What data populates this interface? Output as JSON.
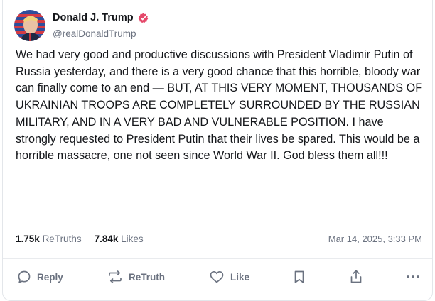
{
  "post": {
    "author_name": "Donald J. Trump",
    "handle": "@realDonaldTrump",
    "text": "We had very good and productive discussions with President Vladimir Putin of Russia yesterday, and there is a very good chance that this horrible, bloody war can finally come to an end — BUT, AT THIS VERY MOMENT, THOUSANDS OF UKRAINIAN TROOPS ARE COMPLETELY SURROUNDED BY THE RUSSIAN MILITARY, AND IN A VERY BAD AND VULNERABLE POSITION. I have strongly requested to President Putin that their lives be spared. This would be a horrible massacre, one not seen since World War II. God bless them all!!!",
    "retruths_count": "1.75k",
    "retruths_label": "ReTruths",
    "likes_count": "7.84k",
    "likes_label": "Likes",
    "timestamp": "Mar 14, 2025, 3:33 PM"
  },
  "actions": {
    "reply_label": "Reply",
    "retruth_label": "ReTruth",
    "like_label": "Like"
  },
  "colors": {
    "verified_badge": "#e5486a",
    "text_primary": "#14161a",
    "text_secondary": "#6b7280"
  },
  "icons": {
    "verified": "verified-badge-icon",
    "reply": "speech-bubble-icon",
    "retruth": "retruth-arrows-icon",
    "like": "heart-icon",
    "bookmark": "bookmark-icon",
    "share": "share-icon",
    "more": "more-dots-icon"
  }
}
